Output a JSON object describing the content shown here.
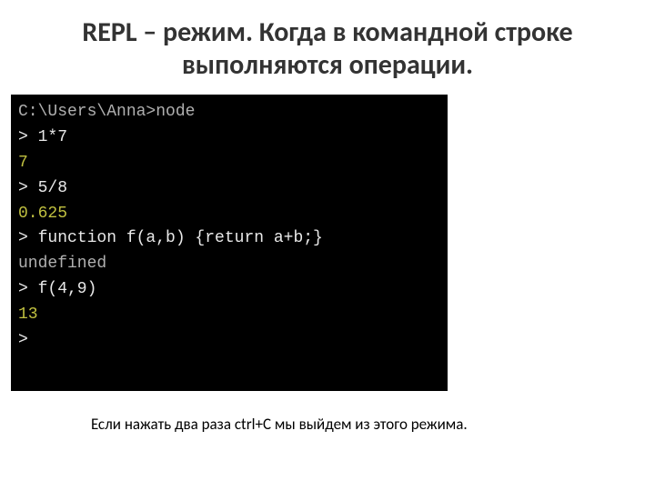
{
  "title": "REPL – режим. Когда в командной строке выполняются операции.",
  "terminal": {
    "lines": [
      {
        "segments": [
          {
            "cls": "c-gray",
            "text": "C:\\Users\\Anna>node"
          }
        ]
      },
      {
        "segments": [
          {
            "cls": "c-white",
            "text": "> 1*7"
          }
        ]
      },
      {
        "segments": [
          {
            "cls": "c-yellow",
            "text": "7"
          }
        ]
      },
      {
        "segments": [
          {
            "cls": "c-white",
            "text": "> 5/8"
          }
        ]
      },
      {
        "segments": [
          {
            "cls": "c-yellow",
            "text": "0.625"
          }
        ]
      },
      {
        "segments": [
          {
            "cls": "c-white",
            "text": "> function f(a,b) {return a+b;}"
          }
        ]
      },
      {
        "segments": [
          {
            "cls": "c-gray",
            "text": "undefined"
          }
        ]
      },
      {
        "segments": [
          {
            "cls": "c-white",
            "text": "> f(4,9)"
          }
        ]
      },
      {
        "segments": [
          {
            "cls": "c-yellow",
            "text": "13"
          }
        ]
      },
      {
        "segments": [
          {
            "cls": "c-white",
            "text": ">"
          }
        ]
      }
    ]
  },
  "caption": "Если нажать два раза ctrl+C мы выйдем из этого режима."
}
